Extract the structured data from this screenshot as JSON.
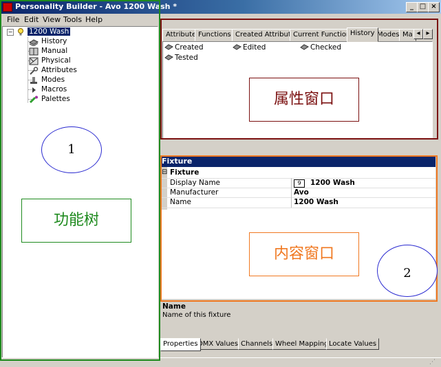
{
  "window": {
    "title": "Personality Builder - Avo 1200 Wash *",
    "minimize": "_",
    "maximize": "□",
    "close": "×"
  },
  "menu": [
    "File",
    "Edit",
    "View",
    "Tools",
    "Help"
  ],
  "tree": {
    "root": "1200 Wash",
    "items": [
      "History",
      "Manual",
      "Physical",
      "Attributes",
      "Modes",
      "Macros",
      "Palettes"
    ]
  },
  "top_tabs": {
    "items": [
      "Attributes",
      "Functions",
      "Created Attributes",
      "Current Functions",
      "History",
      "Modes",
      "Ma"
    ],
    "active": "History"
  },
  "history_items": [
    "Created",
    "Edited",
    "Checked",
    "Tested"
  ],
  "annotations": {
    "circle_1": "1",
    "circle_2": "2",
    "function_tree": "功能树",
    "property_window": "属性窗口",
    "content_window": "内容窗口"
  },
  "properties": {
    "header": "Fixture",
    "category": "Fixture",
    "rows": [
      {
        "key": "Display Name",
        "icon": "9",
        "value": "1200 Wash"
      },
      {
        "key": "Manufacturer",
        "value": "Avo"
      },
      {
        "key": "Name",
        "value": "1200 Wash"
      }
    ],
    "description_title": "Name",
    "description_text": "Name of this fixture"
  },
  "bottom_tabs": {
    "items": [
      "Properties",
      "DMX Values",
      "Channels",
      "Wheel Mapping",
      "Locate Values"
    ],
    "active": "Properties"
  },
  "colors": {
    "annot_green": "#1e8a1e",
    "annot_dark_red": "#7a0f0f",
    "annot_orange": "#f07820",
    "annot_blue": "#2a2ad0",
    "title_blue": "#0a246a"
  }
}
